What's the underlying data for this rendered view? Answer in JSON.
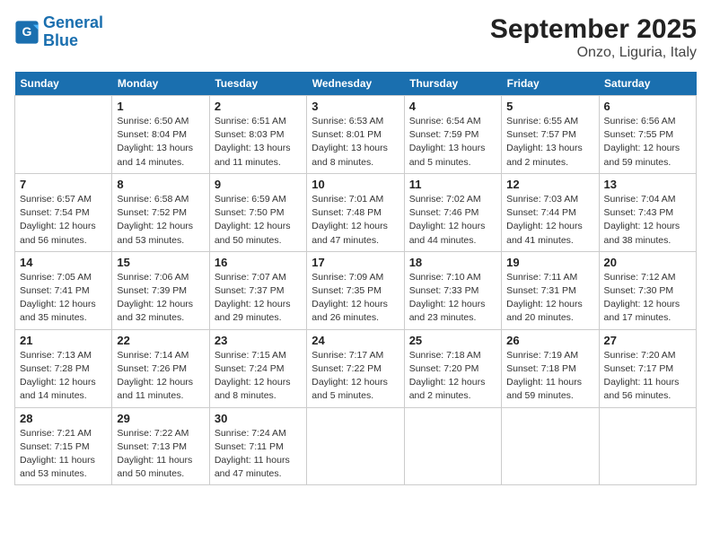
{
  "header": {
    "logo_line1": "General",
    "logo_line2": "Blue",
    "title": "September 2025",
    "subtitle": "Onzo, Liguria, Italy"
  },
  "days_of_week": [
    "Sunday",
    "Monday",
    "Tuesday",
    "Wednesday",
    "Thursday",
    "Friday",
    "Saturday"
  ],
  "weeks": [
    [
      {
        "day": "",
        "info": ""
      },
      {
        "day": "1",
        "info": "Sunrise: 6:50 AM\nSunset: 8:04 PM\nDaylight: 13 hours\nand 14 minutes."
      },
      {
        "day": "2",
        "info": "Sunrise: 6:51 AM\nSunset: 8:03 PM\nDaylight: 13 hours\nand 11 minutes."
      },
      {
        "day": "3",
        "info": "Sunrise: 6:53 AM\nSunset: 8:01 PM\nDaylight: 13 hours\nand 8 minutes."
      },
      {
        "day": "4",
        "info": "Sunrise: 6:54 AM\nSunset: 7:59 PM\nDaylight: 13 hours\nand 5 minutes."
      },
      {
        "day": "5",
        "info": "Sunrise: 6:55 AM\nSunset: 7:57 PM\nDaylight: 13 hours\nand 2 minutes."
      },
      {
        "day": "6",
        "info": "Sunrise: 6:56 AM\nSunset: 7:55 PM\nDaylight: 12 hours\nand 59 minutes."
      }
    ],
    [
      {
        "day": "7",
        "info": "Sunrise: 6:57 AM\nSunset: 7:54 PM\nDaylight: 12 hours\nand 56 minutes."
      },
      {
        "day": "8",
        "info": "Sunrise: 6:58 AM\nSunset: 7:52 PM\nDaylight: 12 hours\nand 53 minutes."
      },
      {
        "day": "9",
        "info": "Sunrise: 6:59 AM\nSunset: 7:50 PM\nDaylight: 12 hours\nand 50 minutes."
      },
      {
        "day": "10",
        "info": "Sunrise: 7:01 AM\nSunset: 7:48 PM\nDaylight: 12 hours\nand 47 minutes."
      },
      {
        "day": "11",
        "info": "Sunrise: 7:02 AM\nSunset: 7:46 PM\nDaylight: 12 hours\nand 44 minutes."
      },
      {
        "day": "12",
        "info": "Sunrise: 7:03 AM\nSunset: 7:44 PM\nDaylight: 12 hours\nand 41 minutes."
      },
      {
        "day": "13",
        "info": "Sunrise: 7:04 AM\nSunset: 7:43 PM\nDaylight: 12 hours\nand 38 minutes."
      }
    ],
    [
      {
        "day": "14",
        "info": "Sunrise: 7:05 AM\nSunset: 7:41 PM\nDaylight: 12 hours\nand 35 minutes."
      },
      {
        "day": "15",
        "info": "Sunrise: 7:06 AM\nSunset: 7:39 PM\nDaylight: 12 hours\nand 32 minutes."
      },
      {
        "day": "16",
        "info": "Sunrise: 7:07 AM\nSunset: 7:37 PM\nDaylight: 12 hours\nand 29 minutes."
      },
      {
        "day": "17",
        "info": "Sunrise: 7:09 AM\nSunset: 7:35 PM\nDaylight: 12 hours\nand 26 minutes."
      },
      {
        "day": "18",
        "info": "Sunrise: 7:10 AM\nSunset: 7:33 PM\nDaylight: 12 hours\nand 23 minutes."
      },
      {
        "day": "19",
        "info": "Sunrise: 7:11 AM\nSunset: 7:31 PM\nDaylight: 12 hours\nand 20 minutes."
      },
      {
        "day": "20",
        "info": "Sunrise: 7:12 AM\nSunset: 7:30 PM\nDaylight: 12 hours\nand 17 minutes."
      }
    ],
    [
      {
        "day": "21",
        "info": "Sunrise: 7:13 AM\nSunset: 7:28 PM\nDaylight: 12 hours\nand 14 minutes."
      },
      {
        "day": "22",
        "info": "Sunrise: 7:14 AM\nSunset: 7:26 PM\nDaylight: 12 hours\nand 11 minutes."
      },
      {
        "day": "23",
        "info": "Sunrise: 7:15 AM\nSunset: 7:24 PM\nDaylight: 12 hours\nand 8 minutes."
      },
      {
        "day": "24",
        "info": "Sunrise: 7:17 AM\nSunset: 7:22 PM\nDaylight: 12 hours\nand 5 minutes."
      },
      {
        "day": "25",
        "info": "Sunrise: 7:18 AM\nSunset: 7:20 PM\nDaylight: 12 hours\nand 2 minutes."
      },
      {
        "day": "26",
        "info": "Sunrise: 7:19 AM\nSunset: 7:18 PM\nDaylight: 11 hours\nand 59 minutes."
      },
      {
        "day": "27",
        "info": "Sunrise: 7:20 AM\nSunset: 7:17 PM\nDaylight: 11 hours\nand 56 minutes."
      }
    ],
    [
      {
        "day": "28",
        "info": "Sunrise: 7:21 AM\nSunset: 7:15 PM\nDaylight: 11 hours\nand 53 minutes."
      },
      {
        "day": "29",
        "info": "Sunrise: 7:22 AM\nSunset: 7:13 PM\nDaylight: 11 hours\nand 50 minutes."
      },
      {
        "day": "30",
        "info": "Sunrise: 7:24 AM\nSunset: 7:11 PM\nDaylight: 11 hours\nand 47 minutes."
      },
      {
        "day": "",
        "info": ""
      },
      {
        "day": "",
        "info": ""
      },
      {
        "day": "",
        "info": ""
      },
      {
        "day": "",
        "info": ""
      }
    ]
  ]
}
